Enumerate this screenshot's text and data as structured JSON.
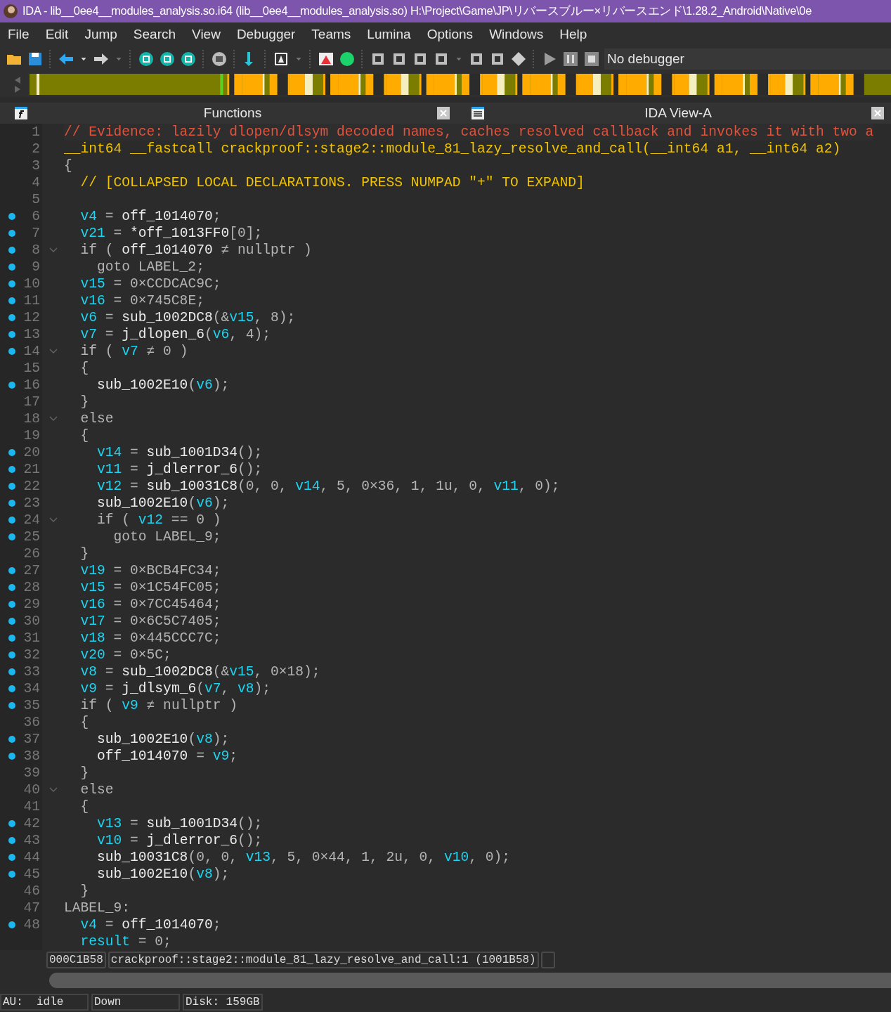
{
  "window": {
    "title": "IDA - lib__0ee4__modules_analysis.so.i64 (lib__0ee4__modules_analysis.so) H:\\Project\\Game\\JP\\リバースブルー×リバースエンド\\1.28.2_Android\\Native\\0e"
  },
  "menu": [
    "File",
    "Edit",
    "Jump",
    "Search",
    "View",
    "Debugger",
    "Teams",
    "Lumina",
    "Options",
    "Windows",
    "Help"
  ],
  "toolbar": {
    "debugger": "No debugger"
  },
  "panels": [
    {
      "title": "Functions",
      "kind": "functions"
    },
    {
      "title": "IDA View-A",
      "kind": "view"
    }
  ],
  "code": [
    {
      "number": "1",
      "dot": false,
      "fold": false,
      "tokens": [
        {
          "kind": "comment",
          "text": "// Evidence: lazily dlopen/dlsym decoded names, caches resolved callback and invokes it with two a"
        }
      ]
    },
    {
      "number": "2",
      "dot": false,
      "fold": false,
      "tokens": [
        {
          "kind": "type",
          "text": "__int64 __fastcall crackproof::stage2::module_81_lazy_resolve_and_call(__int64 a1, __int64 a2)"
        }
      ]
    },
    {
      "number": "3",
      "dot": false,
      "fold": false,
      "tokens": [
        {
          "kind": "plain",
          "text": "{"
        }
      ]
    },
    {
      "number": "4",
      "dot": false,
      "fold": false,
      "tokens": [
        {
          "kind": "type",
          "text": "  // [COLLAPSED LOCAL DECLARATIONS. PRESS NUMPAD \"+\" TO EXPAND]"
        }
      ]
    },
    {
      "number": "5",
      "dot": false,
      "fold": false
    },
    {
      "number": "6",
      "dot": true,
      "fold": false,
      "tokens": [
        {
          "kind": "var",
          "text": "  v4"
        },
        {
          "kind": "plain",
          "text": " = "
        },
        {
          "kind": "name",
          "text": "off_1014070"
        },
        {
          "kind": "plain",
          "text": ";"
        }
      ]
    },
    {
      "number": "7",
      "dot": true,
      "fold": false,
      "tokens": [
        {
          "kind": "var",
          "text": "  v21"
        },
        {
          "kind": "plain",
          "text": " = "
        },
        {
          "kind": "name",
          "text": "*off_1013FF0"
        },
        {
          "kind": "plain",
          "text": "[0];"
        }
      ]
    },
    {
      "number": "8",
      "dot": true,
      "fold": true,
      "tokens": [
        {
          "kind": "plain",
          "text": "  if ( "
        },
        {
          "kind": "name",
          "text": "off_1014070"
        },
        {
          "kind": "plain",
          "text": " ≠ nullptr )"
        }
      ]
    },
    {
      "number": "9",
      "dot": true,
      "fold": false,
      "tokens": [
        {
          "kind": "plain",
          "text": "    goto LABEL_2;"
        }
      ]
    },
    {
      "number": "10",
      "dot": true,
      "fold": false,
      "tokens": [
        {
          "kind": "var",
          "text": "  v15"
        },
        {
          "kind": "plain",
          "text": " = 0×CCDCAC9C;"
        }
      ]
    },
    {
      "number": "11",
      "dot": true,
      "fold": false,
      "tokens": [
        {
          "kind": "var",
          "text": "  v16"
        },
        {
          "kind": "plain",
          "text": " = 0×745C8E;"
        }
      ]
    },
    {
      "number": "12",
      "dot": true,
      "fold": false,
      "tokens": [
        {
          "kind": "var",
          "text": "  v6"
        },
        {
          "kind": "plain",
          "text": " = "
        },
        {
          "kind": "name",
          "text": "sub_1002DC8"
        },
        {
          "kind": "plain",
          "text": "(&"
        },
        {
          "kind": "var",
          "text": "v15"
        },
        {
          "kind": "plain",
          "text": ", 8);"
        }
      ]
    },
    {
      "number": "13",
      "dot": true,
      "fold": false,
      "tokens": [
        {
          "kind": "var",
          "text": "  v7"
        },
        {
          "kind": "plain",
          "text": " = "
        },
        {
          "kind": "name",
          "text": "j_dlopen_6"
        },
        {
          "kind": "plain",
          "text": "("
        },
        {
          "kind": "var",
          "text": "v6"
        },
        {
          "kind": "plain",
          "text": ", 4);"
        }
      ]
    },
    {
      "number": "14",
      "dot": true,
      "fold": true,
      "tokens": [
        {
          "kind": "plain",
          "text": "  if ( "
        },
        {
          "kind": "var",
          "text": "v7"
        },
        {
          "kind": "plain",
          "text": " ≠ 0 )"
        }
      ]
    },
    {
      "number": "15",
      "dot": false,
      "fold": false,
      "tokens": [
        {
          "kind": "plain",
          "text": "  {"
        }
      ]
    },
    {
      "number": "16",
      "dot": true,
      "fold": false,
      "tokens": [
        {
          "kind": "name",
          "text": "    sub_1002E10"
        },
        {
          "kind": "plain",
          "text": "("
        },
        {
          "kind": "var",
          "text": "v6"
        },
        {
          "kind": "plain",
          "text": ");"
        }
      ]
    },
    {
      "number": "17",
      "dot": false,
      "fold": false,
      "tokens": [
        {
          "kind": "plain",
          "text": "  }"
        }
      ]
    },
    {
      "number": "18",
      "dot": false,
      "fold": true,
      "tokens": [
        {
          "kind": "plain",
          "text": "  else"
        }
      ]
    },
    {
      "number": "19",
      "dot": false,
      "fold": false,
      "tokens": [
        {
          "kind": "plain",
          "text": "  {"
        }
      ]
    },
    {
      "number": "20",
      "dot": true,
      "fold": false,
      "tokens": [
        {
          "kind": "var",
          "text": "    v14"
        },
        {
          "kind": "plain",
          "text": " = "
        },
        {
          "kind": "name",
          "text": "sub_1001D34"
        },
        {
          "kind": "plain",
          "text": "();"
        }
      ]
    },
    {
      "number": "21",
      "dot": true,
      "fold": false,
      "tokens": [
        {
          "kind": "var",
          "text": "    v11"
        },
        {
          "kind": "plain",
          "text": " = "
        },
        {
          "kind": "name",
          "text": "j_dlerror_6"
        },
        {
          "kind": "plain",
          "text": "();"
        }
      ]
    },
    {
      "number": "22",
      "dot": true,
      "fold": false,
      "tokens": [
        {
          "kind": "var",
          "text": "    v12"
        },
        {
          "kind": "plain",
          "text": " = "
        },
        {
          "kind": "name",
          "text": "sub_10031C8"
        },
        {
          "kind": "plain",
          "text": "(0, 0, "
        },
        {
          "kind": "var",
          "text": "v14"
        },
        {
          "kind": "plain",
          "text": ", 5, 0×36, 1, 1u, 0, "
        },
        {
          "kind": "var",
          "text": "v11"
        },
        {
          "kind": "plain",
          "text": ", 0);"
        }
      ]
    },
    {
      "number": "23",
      "dot": true,
      "fold": false,
      "tokens": [
        {
          "kind": "name",
          "text": "    sub_1002E10"
        },
        {
          "kind": "plain",
          "text": "("
        },
        {
          "kind": "var",
          "text": "v6"
        },
        {
          "kind": "plain",
          "text": ");"
        }
      ]
    },
    {
      "number": "24",
      "dot": true,
      "fold": true,
      "tokens": [
        {
          "kind": "plain",
          "text": "    if ( "
        },
        {
          "kind": "var",
          "text": "v12"
        },
        {
          "kind": "plain",
          "text": " == 0 )"
        }
      ]
    },
    {
      "number": "25",
      "dot": true,
      "fold": false,
      "tokens": [
        {
          "kind": "plain",
          "text": "      goto LABEL_9;"
        }
      ]
    },
    {
      "number": "26",
      "dot": false,
      "fold": false,
      "tokens": [
        {
          "kind": "plain",
          "text": "  }"
        }
      ]
    },
    {
      "number": "27",
      "dot": true,
      "fold": false,
      "tokens": [
        {
          "kind": "var",
          "text": "  v19"
        },
        {
          "kind": "plain",
          "text": " = 0×BCB4FC34;"
        }
      ]
    },
    {
      "number": "28",
      "dot": true,
      "fold": false,
      "tokens": [
        {
          "kind": "var",
          "text": "  v15"
        },
        {
          "kind": "plain",
          "text": " = 0×1C54FC05;"
        }
      ]
    },
    {
      "number": "29",
      "dot": true,
      "fold": false,
      "tokens": [
        {
          "kind": "var",
          "text": "  v16"
        },
        {
          "kind": "plain",
          "text": " = 0×7CC45464;"
        }
      ]
    },
    {
      "number": "30",
      "dot": true,
      "fold": false,
      "tokens": [
        {
          "kind": "var",
          "text": "  v17"
        },
        {
          "kind": "plain",
          "text": " = 0×6C5C7405;"
        }
      ]
    },
    {
      "number": "31",
      "dot": true,
      "fold": false,
      "tokens": [
        {
          "kind": "var",
          "text": "  v18"
        },
        {
          "kind": "plain",
          "text": " = 0×445CCC7C;"
        }
      ]
    },
    {
      "number": "32",
      "dot": true,
      "fold": false,
      "tokens": [
        {
          "kind": "var",
          "text": "  v20"
        },
        {
          "kind": "plain",
          "text": " = 0×5C;"
        }
      ]
    },
    {
      "number": "33",
      "dot": true,
      "fold": false,
      "tokens": [
        {
          "kind": "var",
          "text": "  v8"
        },
        {
          "kind": "plain",
          "text": " = "
        },
        {
          "kind": "name",
          "text": "sub_1002DC8"
        },
        {
          "kind": "plain",
          "text": "(&"
        },
        {
          "kind": "var",
          "text": "v15"
        },
        {
          "kind": "plain",
          "text": ", 0×18);"
        }
      ]
    },
    {
      "number": "34",
      "dot": true,
      "fold": false,
      "tokens": [
        {
          "kind": "var",
          "text": "  v9"
        },
        {
          "kind": "plain",
          "text": " = "
        },
        {
          "kind": "name",
          "text": "j_dlsym_6"
        },
        {
          "kind": "plain",
          "text": "("
        },
        {
          "kind": "var",
          "text": "v7"
        },
        {
          "kind": "plain",
          "text": ", "
        },
        {
          "kind": "var",
          "text": "v8"
        },
        {
          "kind": "plain",
          "text": ");"
        }
      ]
    },
    {
      "number": "35",
      "dot": true,
      "fold": false,
      "tokens": [
        {
          "kind": "plain",
          "text": "  if ( "
        },
        {
          "kind": "var",
          "text": "v9"
        },
        {
          "kind": "plain",
          "text": " ≠ nullptr )"
        }
      ]
    },
    {
      "number": "36",
      "dot": false,
      "fold": false,
      "tokens": [
        {
          "kind": "plain",
          "text": "  {"
        }
      ]
    },
    {
      "number": "37",
      "dot": true,
      "fold": false,
      "tokens": [
        {
          "kind": "name",
          "text": "    sub_1002E10"
        },
        {
          "kind": "plain",
          "text": "("
        },
        {
          "kind": "var",
          "text": "v8"
        },
        {
          "kind": "plain",
          "text": ");"
        }
      ]
    },
    {
      "number": "38",
      "dot": true,
      "fold": false,
      "tokens": [
        {
          "kind": "name",
          "text": "    off_1014070"
        },
        {
          "kind": "plain",
          "text": " = "
        },
        {
          "kind": "var",
          "text": "v9"
        },
        {
          "kind": "plain",
          "text": ";"
        }
      ]
    },
    {
      "number": "39",
      "dot": false,
      "fold": false,
      "tokens": [
        {
          "kind": "plain",
          "text": "  }"
        }
      ]
    },
    {
      "number": "40",
      "dot": false,
      "fold": true,
      "tokens": [
        {
          "kind": "plain",
          "text": "  else"
        }
      ]
    },
    {
      "number": "41",
      "dot": false,
      "fold": false,
      "tokens": [
        {
          "kind": "plain",
          "text": "  {"
        }
      ]
    },
    {
      "number": "42",
      "dot": true,
      "fold": false,
      "tokens": [
        {
          "kind": "var",
          "text": "    v13"
        },
        {
          "kind": "plain",
          "text": " = "
        },
        {
          "kind": "name",
          "text": "sub_1001D34"
        },
        {
          "kind": "plain",
          "text": "();"
        }
      ]
    },
    {
      "number": "43",
      "dot": true,
      "fold": false,
      "tokens": [
        {
          "kind": "var",
          "text": "    v10"
        },
        {
          "kind": "plain",
          "text": " = "
        },
        {
          "kind": "name",
          "text": "j_dlerror_6"
        },
        {
          "kind": "plain",
          "text": "();"
        }
      ]
    },
    {
      "number": "44",
      "dot": true,
      "fold": false,
      "tokens": [
        {
          "kind": "name",
          "text": "    sub_10031C8"
        },
        {
          "kind": "plain",
          "text": "(0, 0, "
        },
        {
          "kind": "var",
          "text": "v13"
        },
        {
          "kind": "plain",
          "text": ", 5, 0×44, 1, 2u, 0, "
        },
        {
          "kind": "var",
          "text": "v10"
        },
        {
          "kind": "plain",
          "text": ", 0);"
        }
      ]
    },
    {
      "number": "45",
      "dot": true,
      "fold": false,
      "tokens": [
        {
          "kind": "name",
          "text": "    sub_1002E10"
        },
        {
          "kind": "plain",
          "text": "("
        },
        {
          "kind": "var",
          "text": "v8"
        },
        {
          "kind": "plain",
          "text": ");"
        }
      ]
    },
    {
      "number": "46",
      "dot": false,
      "fold": false,
      "tokens": [
        {
          "kind": "plain",
          "text": "  }"
        }
      ]
    },
    {
      "number": "47",
      "dot": false,
      "fold": false,
      "tokens": [
        {
          "kind": "plain",
          "text": "LABEL_9:"
        }
      ]
    },
    {
      "number": "48",
      "dot": true,
      "fold": false,
      "tokens": [
        {
          "kind": "var",
          "text": "  v4"
        },
        {
          "kind": "plain",
          "text": " = "
        },
        {
          "kind": "name",
          "text": "off_1014070"
        },
        {
          "kind": "plain",
          "text": ";"
        }
      ]
    },
    {
      "dot": false,
      "fold": false,
      "tokens": [
        {
          "kind": "var",
          "text": "  result"
        },
        {
          "kind": "plain",
          "text": " = 0;"
        }
      ]
    }
  ],
  "location": {
    "address": "000C1B58",
    "function": "crackproof::stage2::module_81_lazy_resolve_and_call:1 (1001B58)"
  },
  "status_bar": [
    "AU:  idle",
    "Down",
    "Disk: 159GB"
  ]
}
